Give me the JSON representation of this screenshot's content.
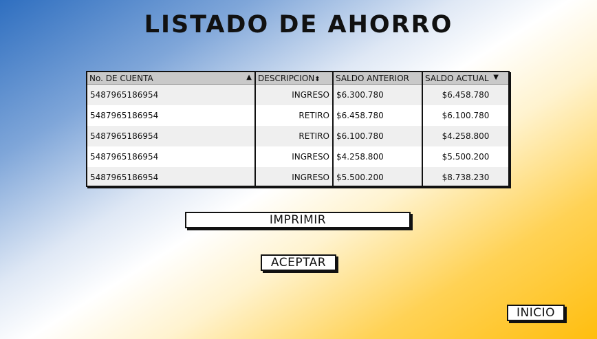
{
  "title": "LISTADO DE AHORRO",
  "table": {
    "columns": [
      {
        "label": "No. DE CUENTA",
        "sort_icon": "triangle-up"
      },
      {
        "label": "DESCRIPCION",
        "sort_icon": "sort-both"
      },
      {
        "label": "SALDO ANTERIOR",
        "sort_icon": ""
      },
      {
        "label": "SALDO ACTUAL",
        "sort_icon": "triangle-down"
      }
    ],
    "rows": [
      [
        "5487965186954",
        "INGRESO",
        "$6.300.780",
        "$6.458.780"
      ],
      [
        "5487965186954",
        "RETIRO",
        "$6.458.780",
        "$6.100.780"
      ],
      [
        "5487965186954",
        "RETIRO",
        "$6.100.780",
        "$4.258.800"
      ],
      [
        "5487965186954",
        "INGRESO",
        "$4.258.800",
        "$5.500.200"
      ],
      [
        "5487965186954",
        "INGRESO",
        "$5.500.200",
        "$8.738.230"
      ]
    ]
  },
  "buttons": {
    "print": "IMPRIMIR",
    "accept": "ACEPTAR",
    "home": "INICIO"
  }
}
